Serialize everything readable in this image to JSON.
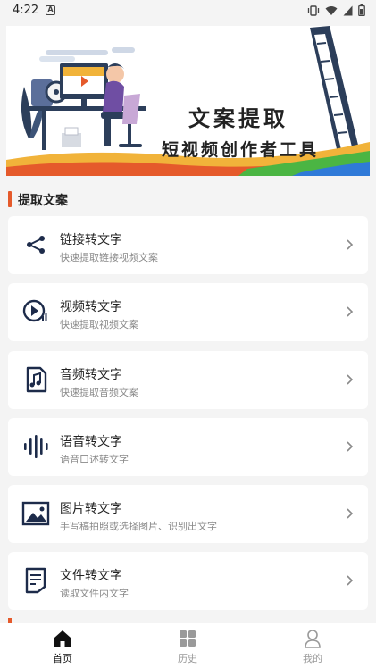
{
  "status_bar": {
    "time": "4:22",
    "notification_glyph": "A",
    "icons": [
      "vibrate-icon",
      "wifi-icon",
      "signal-icon",
      "battery-icon"
    ]
  },
  "banner": {
    "title": "文案提取",
    "subtitle": "短视频创作者工具"
  },
  "section": {
    "title": "提取文案"
  },
  "features": [
    {
      "title": "链接转文字",
      "desc": "快速提取链接视频文案",
      "icon": "share-link-icon"
    },
    {
      "title": "视频转文字",
      "desc": "快速提取视频文案",
      "icon": "video-play-icon"
    },
    {
      "title": "音频转文字",
      "desc": "快速提取音频文案",
      "icon": "music-note-icon"
    },
    {
      "title": "语音转文字",
      "desc": "语音口述转文字",
      "icon": "soundwave-icon"
    },
    {
      "title": "图片转文字",
      "desc": "手写稿拍照或选择图片、识别出文字",
      "icon": "image-icon"
    },
    {
      "title": "文件转文字",
      "desc": "读取文件内文字",
      "icon": "document-icon"
    }
  ],
  "tabbar": {
    "active_color": "#111111",
    "inactive_color": "#9a9a9a",
    "tabs": [
      {
        "label": "首页",
        "icon": "home-icon",
        "active": true
      },
      {
        "label": "历史",
        "icon": "grid-icon",
        "active": false
      },
      {
        "label": "我的",
        "icon": "user-icon",
        "active": false
      }
    ]
  }
}
